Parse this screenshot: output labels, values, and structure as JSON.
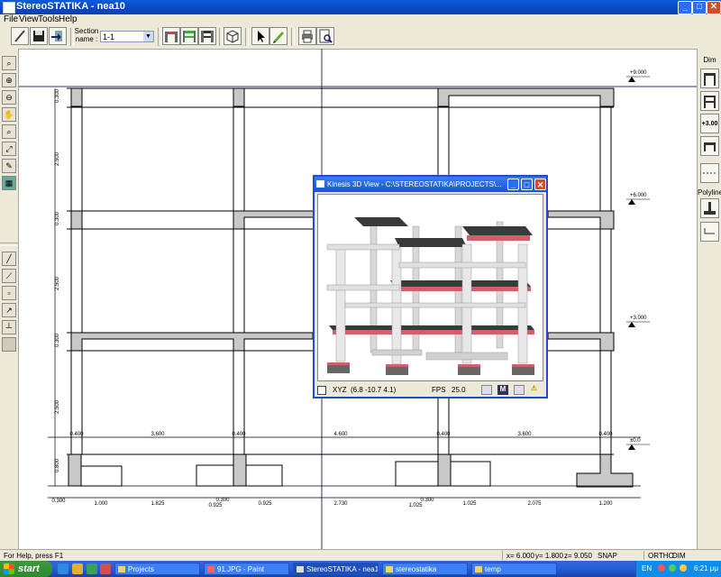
{
  "app": {
    "title": "StereoSTATIKA - nea10",
    "window_buttons": {
      "minimize": "_",
      "maximize": "□",
      "close": "✕"
    }
  },
  "menu": [
    "File",
    "View",
    "Tools",
    "Help"
  ],
  "toolbar": {
    "section_label": "Section name :",
    "section_value": "1-1",
    "buttons": [
      "new-icon",
      "save-icon",
      "export-icon",
      "frame-icon-1",
      "frame-icon-2",
      "frame-icon-3",
      "3d-view-icon",
      "pointer-icon",
      "pencil-icon",
      "print-icon",
      "print-preview-icon"
    ]
  },
  "left_tools": [
    "zoom-icon",
    "zoom-in-icon",
    "zoom-out-icon",
    "pan-icon",
    "zoom-window-icon",
    "zoom-extents-icon",
    "edit-icon",
    "grid-icon",
    "line-icon",
    "polyline-icon",
    "rectangle-icon",
    "dimension-icon",
    "axis-icon",
    "fill-icon"
  ],
  "right_tools": {
    "dim_label": "Dim",
    "polyline_label": "Polyline",
    "level_button_label": "+3.00"
  },
  "drawing": {
    "levels": [
      "+9.000",
      "+6.000",
      "+3.000",
      "±0.0"
    ],
    "vertical_dims": [
      "0.300",
      "2.500",
      "0.300",
      "2.500",
      "0.300",
      "2.500",
      "0.800"
    ],
    "column_widths": [
      "0.400",
      "0.400",
      "0.400",
      "0.400"
    ],
    "spans": [
      "3.600",
      "4.600",
      "3.600"
    ],
    "bottom_dims": [
      "0.300",
      "1.000",
      "1.825",
      "0.300",
      "0.925",
      "0.925",
      "2.730",
      "0.300",
      "1.025",
      "1.025",
      "2.075",
      "1.200"
    ]
  },
  "view3d": {
    "title": "Kinesis 3D View - C:\\STEREOSTATIKA\\PROJECTS\\...",
    "xyz_label": "XYZ",
    "xyz_value": "(6.8 -10.7 4.1)",
    "fps_label": "FPS",
    "fps_value": "25.0",
    "m_button": "M",
    "colors": {
      "column": "#d8d8d8",
      "slab": "#3a3a3a",
      "edge": "#d2606a"
    }
  },
  "statusbar": {
    "help": "For Help, press F1",
    "x": "x= 6.000",
    "y": "y= 1.800",
    "z": "z= 9.050",
    "snap": "SNAP",
    "ortho": "ORTHO",
    "dim": "DIM"
  },
  "taskbar": {
    "start": "start",
    "tasks": [
      "Projects",
      "91.JPG - Paint",
      "StereoSTATIKA - nea10",
      "stereostatika",
      "temp"
    ],
    "lang": "EN",
    "clock": "6:21 μμ"
  }
}
